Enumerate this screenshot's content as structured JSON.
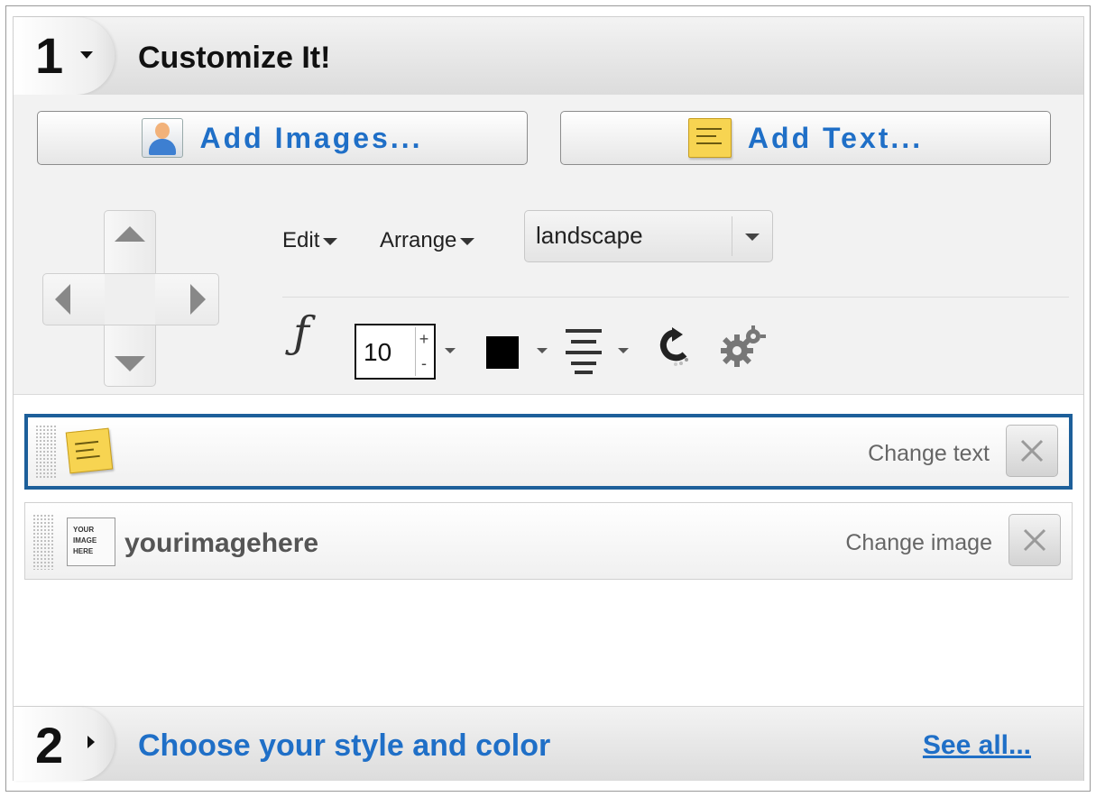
{
  "step1": {
    "number": "1",
    "title": "Customize It!"
  },
  "buttons": {
    "add_images": "Add Images...",
    "add_text": "Add Text..."
  },
  "menus": {
    "edit": "Edit",
    "arrange": "Arrange"
  },
  "orientation": {
    "selected": "landscape"
  },
  "format": {
    "font_glyph": "ƒ",
    "font_size": "10",
    "plus": "+",
    "minus": "-",
    "text_color": "#000000"
  },
  "layers": [
    {
      "type": "text",
      "name": "",
      "action": "Change text",
      "selected": true
    },
    {
      "type": "image",
      "name": "yourimagehere",
      "action": "Change image",
      "selected": false,
      "thumb_lines": [
        "YOUR",
        "IMAGE",
        "HERE"
      ]
    }
  ],
  "step2": {
    "number": "2",
    "title": "Choose your style and color",
    "link": "See all..."
  },
  "colors": {
    "accent": "#1f6fc7",
    "selected_border": "#1d5f9a"
  }
}
